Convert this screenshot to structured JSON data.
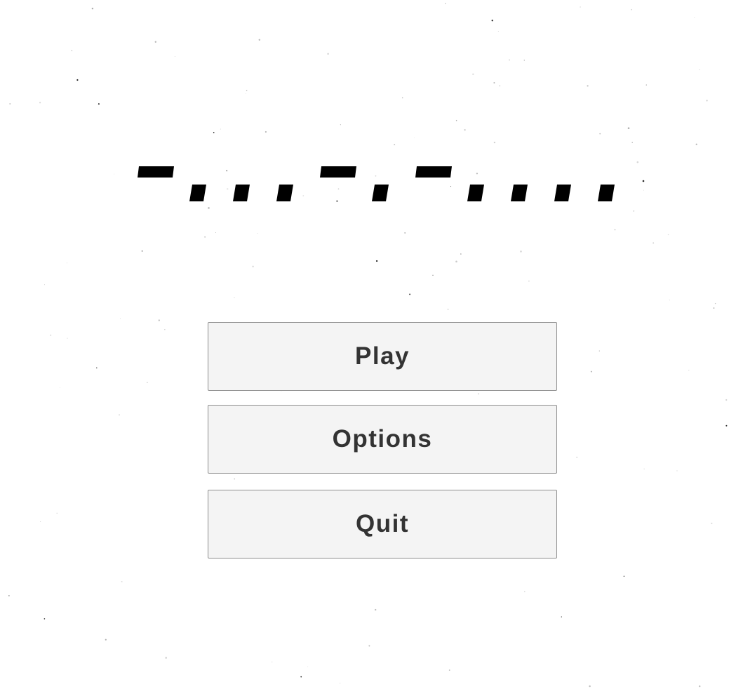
{
  "game": {
    "title_logo": {
      "icon": "morse-code-logo-icon",
      "glyphs": [
        "dash",
        "dot",
        "dot",
        "dot",
        "dash",
        "dot",
        "dash",
        "dot",
        "dot",
        "dot",
        "dot"
      ],
      "color": "#000000"
    },
    "menu": {
      "play_label": "Play",
      "options_label": "Options",
      "quit_label": "Quit"
    },
    "colors": {
      "background": "#ffffff",
      "button_fill": "#f4f4f4",
      "button_border": "#8e8e8e",
      "button_text": "#333333"
    }
  }
}
